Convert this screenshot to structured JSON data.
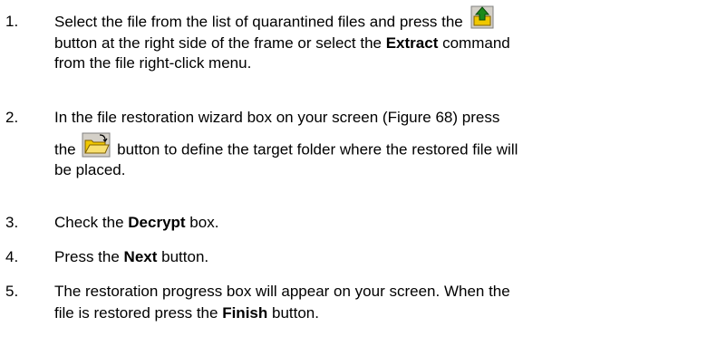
{
  "steps": [
    {
      "number": "1.",
      "line1_pre": "Select the file from the list of quarantined files and press the",
      "line2_pre": "button at the right side of the frame or select the ",
      "line2_bold": "Extract",
      "line2_post": " command",
      "line3": "from the file right-click menu.",
      "icon": "extract-up-arrow-icon"
    },
    {
      "number": "2.",
      "line1": "In the file restoration wizard box on your screen (Figure 68) press",
      "line2_pre": "the",
      "line2_post": "button to define the target folder where the restored file will",
      "line3": "be placed.",
      "icon": "open-folder-icon"
    },
    {
      "number": "3.",
      "pre": "Check the ",
      "bold": "Decrypt",
      "post": " box."
    },
    {
      "number": "4.",
      "pre": "Press the ",
      "bold": "Next",
      "post": " button."
    },
    {
      "number": "5.",
      "line1": "The restoration progress box will appear on your screen. When the",
      "line2_pre": "file is restored press the ",
      "line2_bold": "Finish",
      "line2_post": " button."
    }
  ],
  "colors": {
    "text": "#000000",
    "icon_green": "#1a8a1a",
    "icon_yellow": "#f0c800",
    "icon_border": "#808080"
  }
}
